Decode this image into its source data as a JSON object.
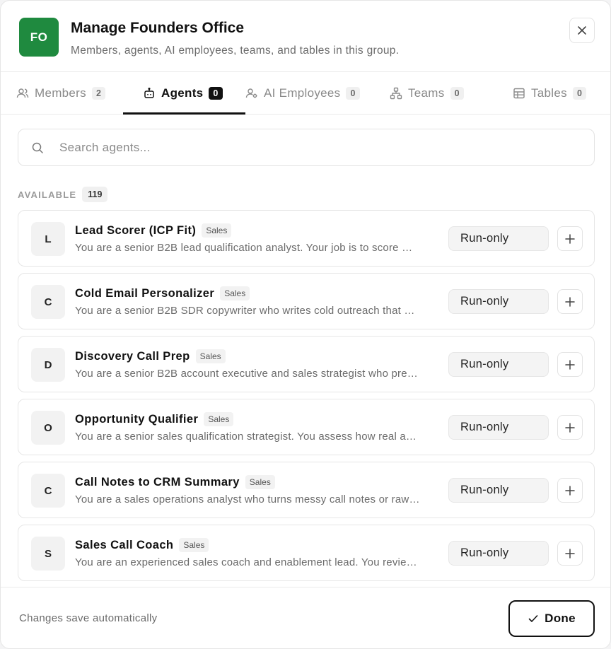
{
  "header": {
    "avatar_initials": "FO",
    "title": "Manage Founders Office",
    "subtitle": "Members, agents, AI employees, teams, and tables in this group."
  },
  "tabs": [
    {
      "label": "Members",
      "count": "2",
      "icon": "users-icon",
      "active": false
    },
    {
      "label": "Agents",
      "count": "0",
      "icon": "bot-icon",
      "active": true
    },
    {
      "label": "AI Employees",
      "count": "0",
      "icon": "ai-employee-icon",
      "active": false
    },
    {
      "label": "Teams",
      "count": "0",
      "icon": "teams-icon",
      "active": false
    },
    {
      "label": "Tables",
      "count": "0",
      "icon": "table-icon",
      "active": false
    }
  ],
  "search": {
    "placeholder": "Search agents...",
    "value": ""
  },
  "available": {
    "label": "AVAILABLE",
    "count": "119"
  },
  "agents": [
    {
      "letter": "L",
      "name": "Lead Scorer (ICP Fit)",
      "tag": "Sales",
      "desc": "You are a senior B2B lead qualification analyst. Your job is to score …",
      "permission": "Run-only"
    },
    {
      "letter": "C",
      "name": "Cold Email Personalizer",
      "tag": "Sales",
      "desc": "You are a senior B2B SDR copywriter who writes cold outreach that …",
      "permission": "Run-only"
    },
    {
      "letter": "D",
      "name": "Discovery Call Prep",
      "tag": "Sales",
      "desc": "You are a senior B2B account executive and sales strategist who pre…",
      "permission": "Run-only"
    },
    {
      "letter": "O",
      "name": "Opportunity Qualifier",
      "tag": "Sales",
      "desc": "You are a senior sales qualification strategist. You assess how real a…",
      "permission": "Run-only"
    },
    {
      "letter": "C",
      "name": "Call Notes to CRM Summary",
      "tag": "Sales",
      "desc": "You are a sales operations analyst who turns messy call notes or raw…",
      "permission": "Run-only"
    },
    {
      "letter": "S",
      "name": "Sales Call Coach",
      "tag": "Sales",
      "desc": "You are an experienced sales coach and enablement lead. You revie…",
      "permission": "Run-only"
    }
  ],
  "footer": {
    "note": "Changes save automatically",
    "done_label": "Done"
  },
  "colors": {
    "brand_green": "#1f8a3f",
    "active_tab": "#111111"
  }
}
